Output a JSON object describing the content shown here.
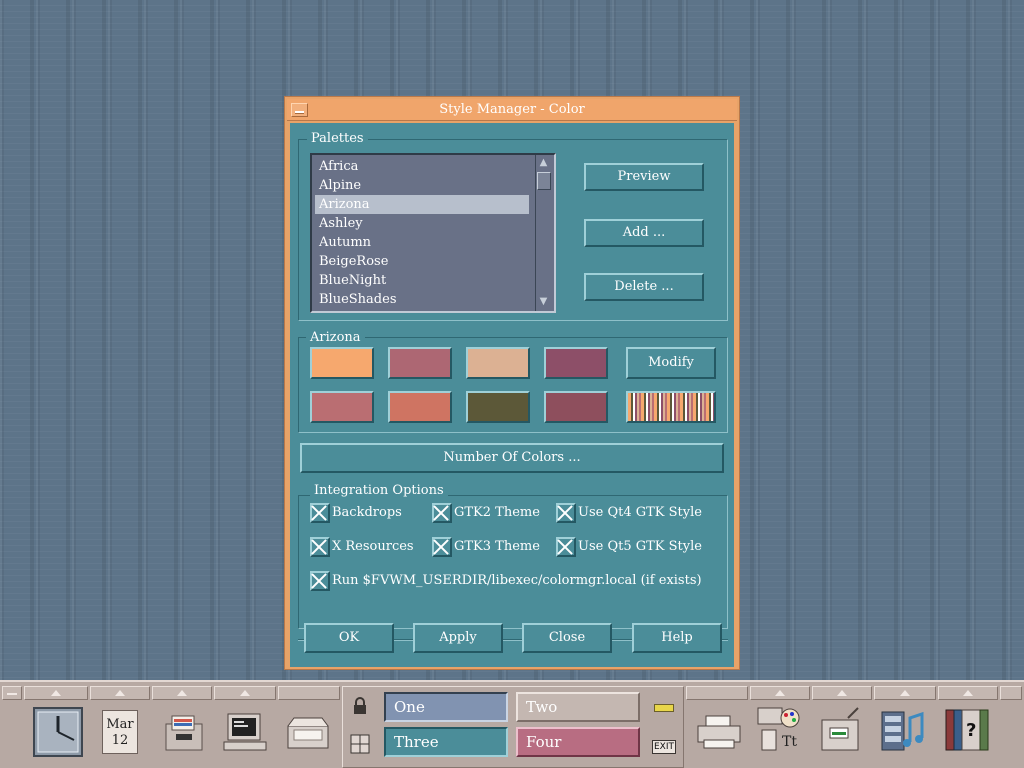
{
  "window": {
    "title": "Style Manager - Color",
    "menu_button_icon": "window-menu-icon"
  },
  "palettes": {
    "group_label": "Palettes",
    "items": [
      "Africa",
      "Alpine",
      "Arizona",
      "Ashley",
      "Autumn",
      "BeigeRose",
      "BlueNight",
      "BlueShades"
    ],
    "selected": "Arizona",
    "buttons": {
      "preview": "Preview",
      "add": "Add ...",
      "delete": "Delete ..."
    }
  },
  "current_palette": {
    "group_label": "Arizona",
    "modify_label": "Modify",
    "swatches": [
      "#f6a86e",
      "#ad6773",
      "#dcb193",
      "#8d4f68",
      "#ba6e72",
      "#cf7462",
      "#5c5838",
      "#8e4f5d"
    ]
  },
  "number_of_colors_label": "Number Of Colors ...",
  "integration": {
    "group_label": "Integration Options",
    "options": [
      {
        "label": "Backdrops",
        "checked": true
      },
      {
        "label": "GTK2 Theme",
        "checked": true
      },
      {
        "label": "Use Qt4 GTK Style",
        "checked": true
      },
      {
        "label": "X Resources",
        "checked": true
      },
      {
        "label": "GTK3 Theme",
        "checked": true
      },
      {
        "label": "Use Qt5 GTK Style",
        "checked": true
      },
      {
        "label": "Run $FVWM_USERDIR/libexec/colormgr.local (if exists)",
        "checked": true
      }
    ]
  },
  "dialog_buttons": {
    "ok": "OK",
    "apply": "Apply",
    "close": "Close",
    "help": "Help"
  },
  "front_panel": {
    "date": {
      "month": "Mar",
      "day": "12"
    },
    "workspaces": [
      "One",
      "Two",
      "Three",
      "Four"
    ],
    "active_workspace": "One",
    "exit_label": "EXIT",
    "icons": [
      "clock-icon",
      "calendar-icon",
      "file-manager-icon",
      "terminal-icon",
      "mail-icon",
      "lock-icon",
      "workspace-grid-icon",
      "busy-light-icon",
      "printer-icon",
      "style-manager-icon",
      "app-manager-icon",
      "media-icon",
      "help-icon"
    ]
  },
  "colors": {
    "window_border": "#e8a368",
    "client_bg": "#4b8d99",
    "list_bg": "#697187",
    "list_selected": "#b7bfcc",
    "panel_bg": "#b7a9a3"
  }
}
